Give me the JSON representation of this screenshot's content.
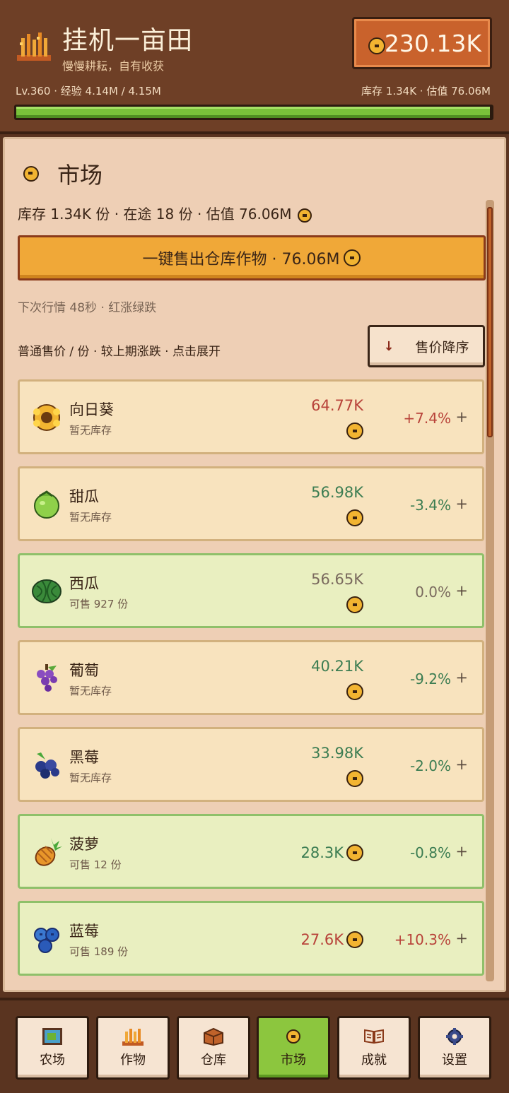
{
  "header": {
    "title": "挂机一亩田",
    "subtitle": "慢慢耕耘，自有收获",
    "level_line": "Lv.360 · 经验 4.14M / 4.15M",
    "stock_line": "库存 1.34K · 估值 76.06M",
    "coins": "230.13K",
    "xp_progress": 0.9976
  },
  "market": {
    "title": "市场",
    "summary": "库存 1.34K 份 · 在途 18 份 · 估值 76.06M",
    "sell_all_label": "一键售出仓库作物 · 76.06M",
    "next_tick": "下次行情 48秒 · 红涨绿跌",
    "sort_desc": "普通售价 / 份 · 较上期涨跌 · 点击展开",
    "sort_button": "售价降序",
    "sort_icon": "arrow-down-icon",
    "rows": [
      {
        "name": "向日葵",
        "status": "暂无库存",
        "price": "64.77K",
        "change": "+7.4%",
        "icon": "sunflower-icon"
      },
      {
        "name": "甜瓜",
        "status": "暂无库存",
        "price": "56.98K",
        "change": "-3.4%",
        "icon": "melon-icon"
      },
      {
        "name": "西瓜",
        "status": "可售 927 份",
        "price": "56.65K",
        "change": "0.0%",
        "icon": "watermelon-icon"
      },
      {
        "name": "葡萄",
        "status": "暂无库存",
        "price": "40.21K",
        "change": "-9.2%",
        "icon": "grape-icon"
      },
      {
        "name": "黑莓",
        "status": "暂无库存",
        "price": "33.98K",
        "change": "-2.0%",
        "icon": "blackberry-icon"
      },
      {
        "name": "菠萝",
        "status": "可售 12 份",
        "price": "28.3K",
        "change": "-0.8%",
        "icon": "pineapple-icon"
      },
      {
        "name": "蓝莓",
        "status": "可售 189 份",
        "price": "27.6K",
        "change": "+10.3%",
        "icon": "blueberry-icon"
      }
    ],
    "expand_symbol": "+"
  },
  "nav": {
    "tabs": [
      {
        "label": "农场",
        "icon": "farm-map-icon"
      },
      {
        "label": "作物",
        "icon": "wheat-icon"
      },
      {
        "label": "仓库",
        "icon": "box-icon"
      },
      {
        "label": "市场",
        "icon": "coin-icon"
      },
      {
        "label": "成就",
        "icon": "book-icon"
      },
      {
        "label": "设置",
        "icon": "gear-icon"
      }
    ],
    "active": "市场"
  },
  "colors": {
    "header_bg": "#6e3f26",
    "panel_bg": "#eecfb5",
    "accent_orange": "#f0a838",
    "coin_box": "#c9622c",
    "price_up": "#b8433a",
    "price_down": "#3c7d52",
    "active_tab": "#8cc63e"
  }
}
